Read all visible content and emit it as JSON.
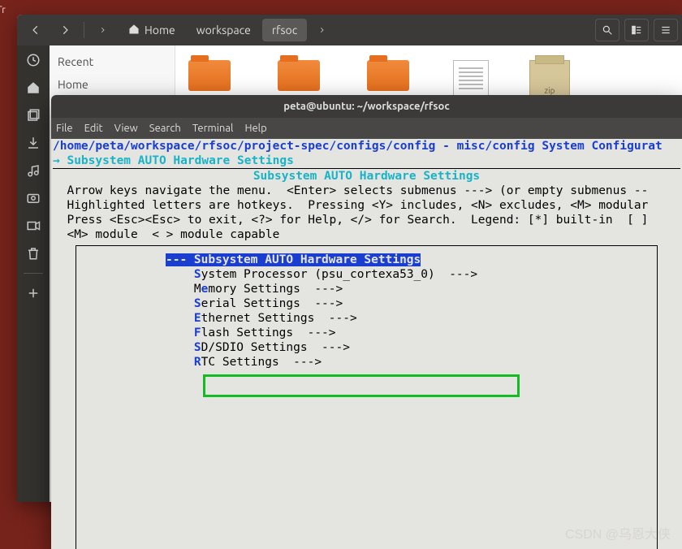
{
  "desktop": {
    "trash_label": "Tr"
  },
  "filemanager": {
    "path": {
      "home": "Home",
      "crumb1": "workspace",
      "crumb2": "rfsoc"
    },
    "sidebar_recent": "Recent",
    "sidebar_home": "Home",
    "zip_label": "zip"
  },
  "terminal": {
    "title": "peta@ubuntu: ~/workspace/rfsoc",
    "menus": {
      "file": "File",
      "edit": "Edit",
      "view": "View",
      "search": "Search",
      "terminal": "Terminal",
      "help": "Help"
    },
    "path_line": "/home/peta/workspace/rfsoc/project-spec/configs/config - misc/config System Configurat",
    "breadcrumb_prefix": "→ ",
    "breadcrumb": "Subsystem AUTO Hardware Settings ",
    "heading": "Subsystem AUTO Hardware Settings",
    "help1": "  Arrow keys navigate the menu.  <Enter> selects submenus ---> (or empty submenus --",
    "help2": "  Highlighted letters are hotkeys.  Pressing <Y> includes, <N> excludes, <M> modular",
    "help3": "  Press <Esc><Esc> to exit, <?> for Help, </> for Search.  Legend: [*] built-in  [ ]",
    "help4": "  <M> module  < > module capable",
    "section_head": "--- Subsystem AUTO Hardware Settings",
    "items": [
      {
        "hot": "S",
        "rest": "ystem Processor (psu_cortexa53_0)  --->"
      },
      {
        "hot": "e",
        "pre": "M",
        "rest": "mory Settings  --->"
      },
      {
        "hot": "S",
        "rest": "erial Settings  --->"
      },
      {
        "hot": "E",
        "rest": "thernet Settings  --->"
      },
      {
        "hot": "F",
        "rest": "lash Settings  --->"
      },
      {
        "hot": "S",
        "rest": "D/SDIO Settings  --->"
      },
      {
        "hot": "R",
        "rest": "TC Settings  --->"
      }
    ]
  },
  "watermark": "CSDN @乌恩大侠"
}
